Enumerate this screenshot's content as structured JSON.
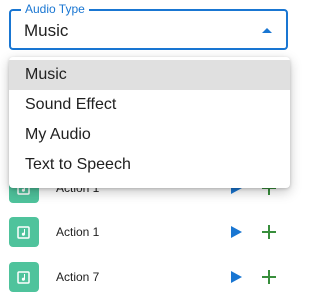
{
  "select": {
    "label": "Audio Type",
    "value": "Music",
    "options": [
      "Music",
      "Sound Effect",
      "My Audio",
      "Text to Speech"
    ],
    "selected_index": 0
  },
  "list": {
    "items": [
      {
        "label": "Action 1"
      },
      {
        "label": "Action 1"
      },
      {
        "label": "Action 7"
      }
    ]
  },
  "colors": {
    "accent": "#1976d2",
    "thumb": "#4fc39c",
    "add": "#388e3c",
    "play": "#1976d2"
  },
  "icons": {
    "thumb": "music-note-icon",
    "play": "play-icon",
    "add": "plus-icon",
    "caret": "caret-up-icon"
  }
}
